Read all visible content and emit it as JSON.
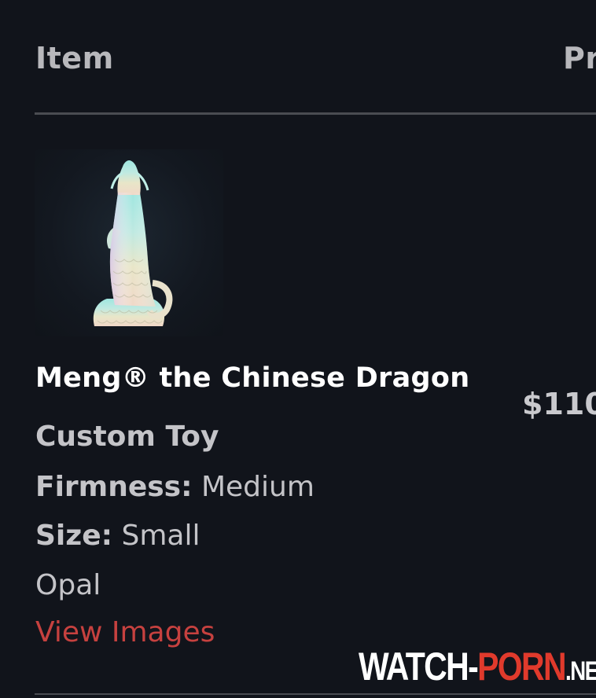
{
  "header": {
    "item_label": "Item",
    "price_label": "Pr"
  },
  "product": {
    "thumbnail_icon": "dragon-figure-image",
    "title": "Meng® the Chinese Dragon",
    "price": "$110",
    "type": "Custom Toy",
    "firmness_label": "Firmness:",
    "firmness_value": "Medium",
    "size_label": "Size:",
    "size_value": "Small",
    "color": "Opal",
    "view_images_link": "View Images"
  },
  "watermark": {
    "part1": "WATCH-",
    "part2": "PORN",
    "part3": ".NET"
  },
  "colors": {
    "background": "#11141b",
    "link": "#c6413f",
    "watermark_accent": "#e03a2c"
  }
}
